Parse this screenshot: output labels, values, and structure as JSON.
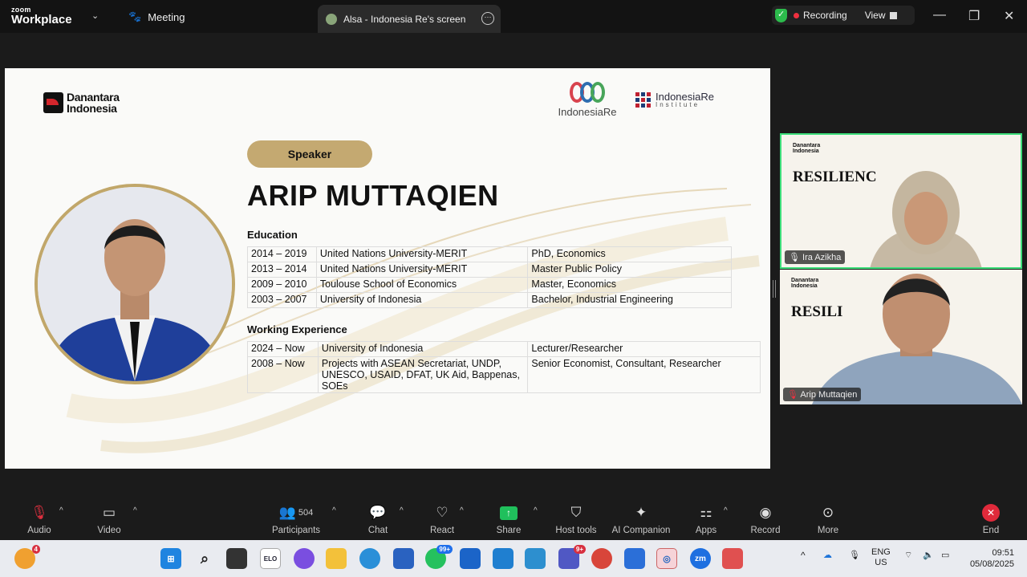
{
  "zoom": {
    "brand_top": "zoom",
    "brand_bottom": "Workplace",
    "meeting_label": "Meeting"
  },
  "tab": {
    "title": "Alsa - Indonesia Re's screen"
  },
  "recording": {
    "label": "Recording",
    "view_label": "View"
  },
  "slide": {
    "danantara_line1": "Danantara",
    "danantara_line2": "Indonesia",
    "indonesiare_logo": "IndonesiaRe",
    "institute_logo_line1": "IndonesiaRe",
    "institute_logo_line2": "Institute",
    "speaker_pill": "Speaker",
    "speaker_name": "ARIP MUTTAQIEN",
    "education_heading": "Education",
    "education": [
      {
        "years": "2014 – 2019",
        "school": "United Nations University-MERIT",
        "degree": "PhD, Economics"
      },
      {
        "years": "2013 – 2014",
        "school": "United Nations University-MERIT",
        "degree": "Master Public Policy"
      },
      {
        "years": "2009 – 2010",
        "school": "Toulouse School of Economics",
        "degree": "Master, Economics"
      },
      {
        "years": "2003 – 2007",
        "school": "University of Indonesia",
        "degree": "Bachelor, Industrial Engineering"
      }
    ],
    "work_heading": "Working Experience",
    "work": [
      {
        "years": "2024 – Now",
        "org": "University of Indonesia",
        "role": "Lecturer/Researcher"
      },
      {
        "years": "2008 – Now",
        "org": "Projects with ASEAN Secretariat, UNDP, UNESCO, USAID, DFAT, UK Aid, Bappenas, SOEs",
        "role": "Senior Economist, Consultant, Researcher"
      }
    ]
  },
  "gallery": [
    {
      "name": "Ira Azikha",
      "bg_title": "RESILIENC"
    },
    {
      "name": "Arip Muttaqien",
      "bg_title": "RESILI"
    }
  ],
  "toolbar": {
    "audio": "Audio",
    "video": "Video",
    "participants": "Participants",
    "participants_count": "504",
    "chat": "Chat",
    "react": "React",
    "share": "Share",
    "host_tools": "Host tools",
    "ai_companion": "AI Companion",
    "apps": "Apps",
    "record": "Record",
    "more": "More",
    "end": "End"
  },
  "taskbar": {
    "weather_badge": "4",
    "elo": "ELO",
    "whatsapp_badge": "99+",
    "teams_badge": "9+",
    "lang_top": "ENG",
    "lang_bottom": "US",
    "time": "09:51",
    "date": "05/08/2025",
    "zoom_app": "zm"
  },
  "colors": {
    "accent_green": "#2cbb4c",
    "record_red": "#f0303f",
    "gold": "#c4a971",
    "end_red": "#e02a3b",
    "share_green": "#20c05c"
  }
}
